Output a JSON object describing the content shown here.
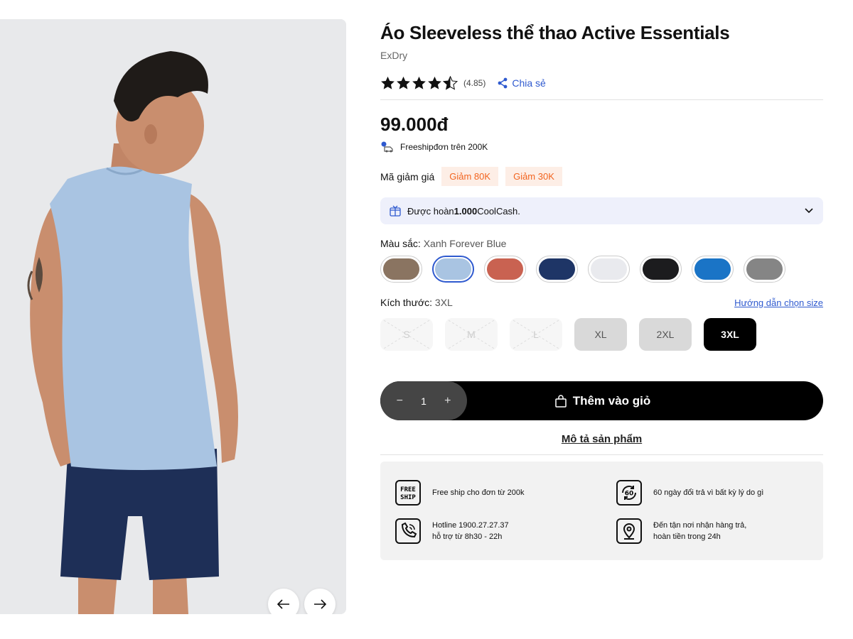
{
  "product": {
    "title": "Áo Sleeveless thể thao Active Essentials",
    "brand": "ExDry",
    "rating": 4.85,
    "rating_text": "(4.85)",
    "share_label": "Chia sẻ",
    "price": "99.000đ",
    "freeship_text": "Freeshipđơn trên 200K"
  },
  "coupons": {
    "label": "Mã giảm giá",
    "items": [
      "Giảm 80K",
      "Giảm 30K"
    ]
  },
  "cashback": {
    "prefix": "Được hoàn ",
    "amount": "1.000",
    "suffix": " CoolCash."
  },
  "color": {
    "label": "Màu sắc: ",
    "selected": "Xanh Forever Blue",
    "swatches": [
      "#8a7461",
      "#a9c4e2",
      "#c96251",
      "#1e3566",
      "#e9eaee",
      "#1c1c1e",
      "#1a74c6",
      "#858585"
    ],
    "selected_index": 1
  },
  "size": {
    "label": "Kích thước: ",
    "selected": "3XL",
    "guide_label": "Hướng dẫn chọn size",
    "options": [
      "S",
      "M",
      "L",
      "XL",
      "2XL",
      "3XL"
    ]
  },
  "cart": {
    "minus": "−",
    "quantity": "1",
    "plus": "+",
    "add_label": "Thêm vào giỏ"
  },
  "description_link": "Mô tả sản phẩm",
  "policies": {
    "freeship": "Free ship cho đơn từ 200k",
    "returns": "60 ngày đổi trả vì bất kỳ lý do gì",
    "hotline_line1": "Hotline 1900.27.27.37",
    "hotline_line2": "hỗ trợ từ 8h30 - 22h",
    "pickup_line1": "Đến tận nơi nhận hàng trả,",
    "pickup_line2": "hoàn tiền trong 24h",
    "freeship_icon_top": "FREE",
    "freeship_icon_bottom": "SHIP",
    "returns_icon_text": "60"
  },
  "colors_ui": {
    "accent_blue": "#2f5acf",
    "coupon_orange": "#f2641f",
    "coupon_bg": "#fdeee6",
    "cashback_bg": "#eef0fb"
  }
}
